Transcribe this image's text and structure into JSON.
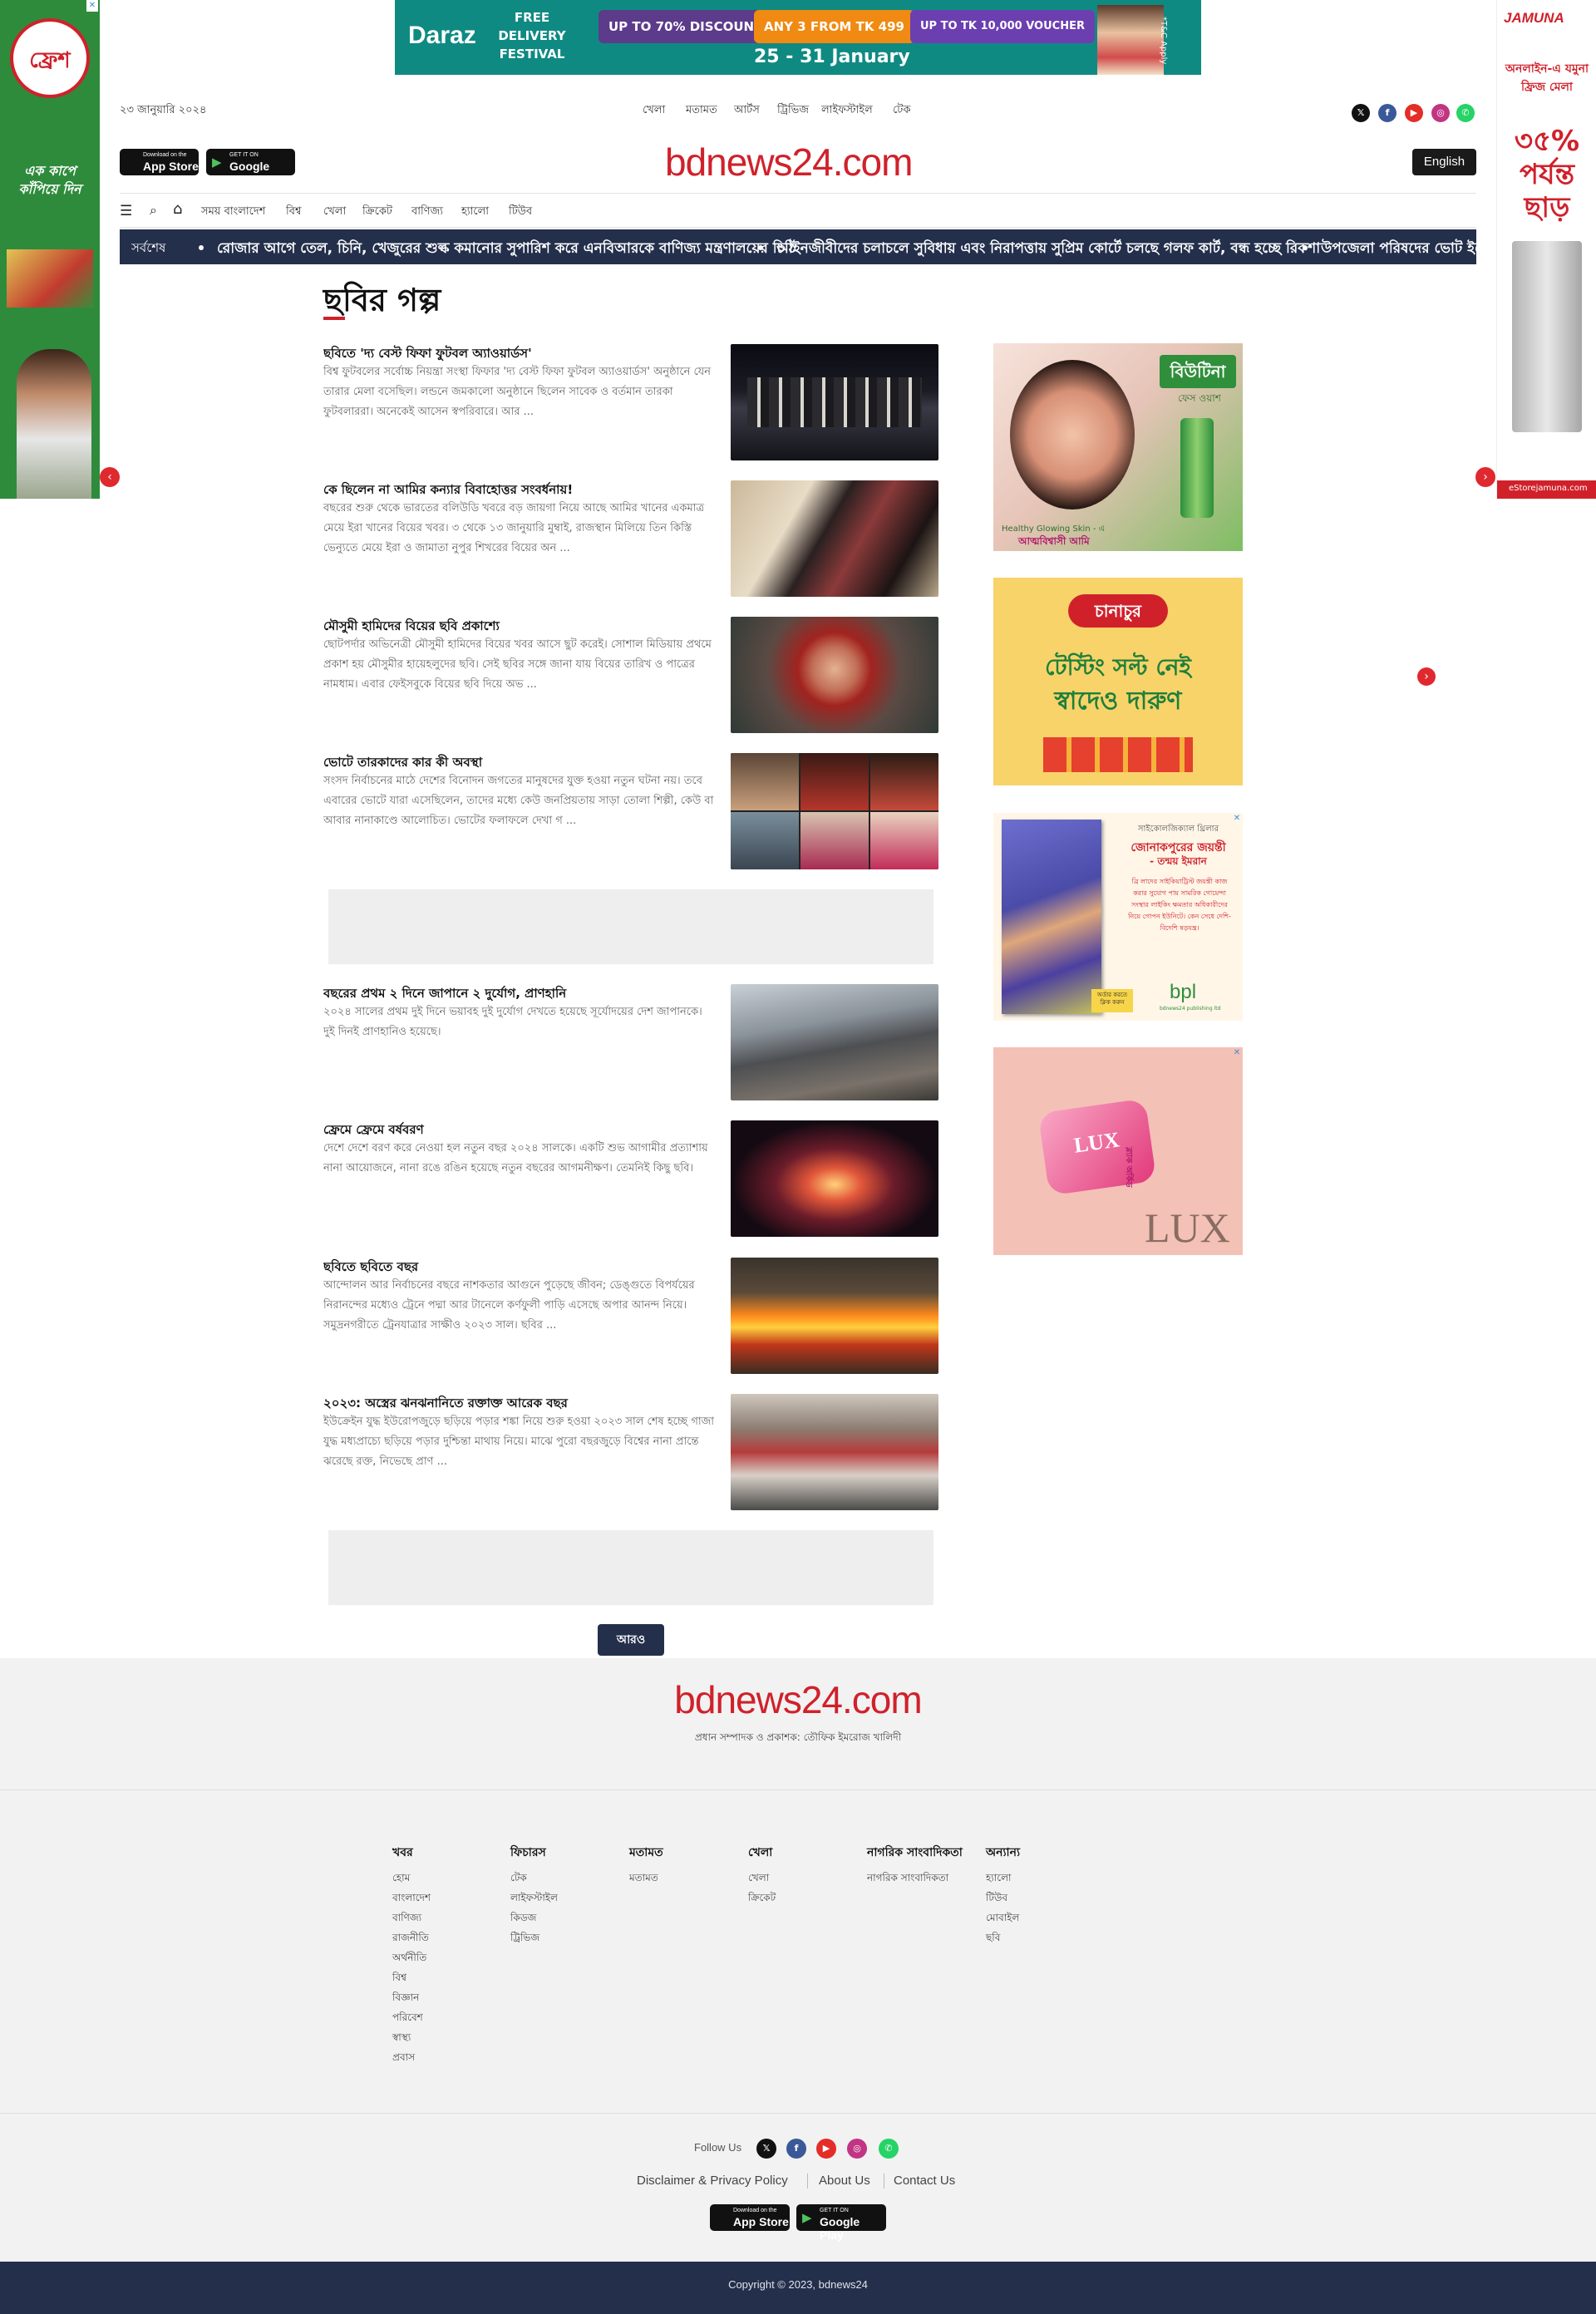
{
  "top_banner": {
    "brand": "Daraz",
    "headline": "FREE DELIVERY FESTIVAL",
    "offers": [
      "UP TO 70% DISCOUNT",
      "ANY 3 FROM TK 499",
      "UP TO TK 10,000 VOUCHER"
    ],
    "dates": "25 - 31 January",
    "note": "*T&C Apply"
  },
  "left_ad": {
    "brand": "ফ্রেশ",
    "slogan": "এক কাপে কাঁপিয়ে দিন"
  },
  "right_ad": {
    "brand": "JAMUNA",
    "tagline": "অনলাইন-এ যমুনা ফ্রিজ মেলা",
    "offer": "৩৫% পর্যন্ত ছাড়",
    "url": "eStorejamuna.com"
  },
  "header": {
    "date": "২৩ জানুয়ারি ২০২৪",
    "top_links": [
      "খেলা",
      "মতামত",
      "আর্টস",
      "ট্রিভিজ",
      "লাইফস্টাইল",
      "টেক"
    ],
    "social": [
      "x-icon",
      "facebook-icon",
      "youtube-icon",
      "instagram-icon",
      "whatsapp-icon"
    ],
    "app_store": {
      "small": "Download on the",
      "big": "App Store"
    },
    "google_play": {
      "small": "GET IT ON",
      "big": "Google Play"
    },
    "logo": "bdnews24.com",
    "english_button": "English"
  },
  "menu": {
    "items": [
      "সময় বাংলাদেশ",
      "বিশ্ব",
      "খেলা",
      "ক্রিকেট",
      "বাণিজ্য",
      "হ্যালো",
      "টিউব"
    ]
  },
  "ticker": {
    "label": "সর্বশেষ",
    "items": [
      "রোজার আগে তেল, চিনি, খেজুরের শুল্ক কমানোর সুপারিশ করে এনবিআরকে বাণিজ্য মন্ত্রণালয়ের চিঠি",
      "আইনজীবীদের চলাচলে সুবিধায় এবং নিরাপত্তায় সুপ্রিম কোর্টে চলছে গলফ কার্ট, বন্ধ হচ্ছে রিকশা",
      "উপজেলা পরিষদের ভোট ইভে"
    ]
  },
  "section": {
    "title": "ছবির গল্প"
  },
  "stories": [
    {
      "title": "ছবিতে 'দ্য বেস্ট ফিফা ফুটবল অ্যাওয়ার্ডস'",
      "body": "বিশ্ব ফুটবলের সর্বোচ্চ নিয়ন্ত্রা সংস্থা ফিফার 'দ্য বেস্ট ফিফা ফুটবল অ্যাওয়ার্ডস' অনুষ্ঠানে যেন তারার মেলা বসেছিল। লন্ডনে জমকালো অনুষ্ঠানে ছিলেন সাবেক ও বর্তমান তারকা ফুটবলাররা। অনেকেই আসেন স্বপরিবারে। আর ..."
    },
    {
      "title": "কে ছিলেন না আমির কন্যার বিবাহোত্তর সংবর্ধনায়!",
      "body": "বছরের শুরু থেকে ভারতের বলিউডি খবরে বড় জায়গা নিয়ে আছে আমির খানের একমাত্র মেয়ে ইরা খানের বিয়ের খবর। ৩ থেকে ১৩ জানুয়ারি মুম্বাই, রাজস্থান মিলিয়ে তিন কিস্তি ভেন্যুতে মেয়ে ইরা ও জামাতা নুপুর শিখরের বিয়ের অন ..."
    },
    {
      "title": "মৌসুমী হামিদের বিয়ের ছবি প্রকাশ্যে",
      "body": "ছোটপর্দার অভিনেত্রী মৌসুমী হামিদের বিয়ের খবর আসে ছুট করেই। সোশাল মিডিয়ায় প্রথমে প্রকাশ হয় মৌসুমীর হায়েহলুদের ছবি। সেই ছবির সঙ্গে জানা যায় বিয়ের তারিখ ও পাত্রের নামধাম। এবার ফেইসবুকে বিয়ের ছবি দিয়ে অভ ..."
    },
    {
      "title": "ভোটে তারকাদের কার কী অবস্থা",
      "body": "সংসদ নির্বাচনের মাঠে দেশের বিনোদন জগতের মানুষদের যুক্ত হওয়া নতুন ঘটনা নয়। তবে এবারের ভোটে যারা এসেছিলেন, তাদের মধ্যে কেউ জনপ্রিয়তায় সাড়া তোলা শিল্পী, কেউ বা আবার নানাকাণ্ডে আলোচিত। ভোটের ফলাফলে দেখা গ ..."
    },
    {
      "title": "বছরের প্রথম ২ দিনে জাপানে ২ দুর্যোগ, প্রাণহানি",
      "body": "২০২৪ সালের প্রথম দুই দিনে ভয়াবহ দুই দুর্যোগ দেখতে হয়েছে সূর্যোদয়ের দেশ জাপানকে। দুই দিনই প্রাণহানিও হয়েছে।"
    },
    {
      "title": "ফ্রেমে ফ্রেমে বর্ষবরণ",
      "body": "দেশে দেশে বরণ করে নেওয়া হল নতুন বছর ২০২৪ সালকে। একটি শুভ আগামীর প্রত্যাশায় নানা আয়োজনে, নানা রঙে রঙিন হয়েছে নতুন বছরের আগমনীক্ষণ। তেমনিই কিছু ছবি।"
    },
    {
      "title": "ছবিতে ছবিতে বছর",
      "body": "আন্দোলন আর নির্বাচনের বছরে নাশকতার আগুনে পুড়েছে জীবন; ডেঙ্গুতে বিপর্যয়ের নিরানন্দের মধ্যেও ট্রেনে পদ্মা আর টানেলে কর্ণফুলী পাড়ি এসেছে অপার আনন্দ নিয়ে। সমুদ্রনগরীতে ট্রেনযাত্রার সাক্ষীও ২০২৩ সাল। ছবির ..."
    },
    {
      "title": "২০২৩: অস্ত্রের ঝনঝনানিতে রক্তাক্ত আরেক বছর",
      "body": "ইউক্রেইন যুদ্ধ ইউরোপজুড়ে ছড়িয়ে পড়ার শঙ্কা নিয়ে শুরু হওয়া ২০২৩ সাল শেষ হচ্ছে গাজা যুদ্ধ মধ্যপ্রাচ্যে ছড়িয়ে পড়ার দুশ্চিন্তা মাথায় নিয়ে। মাঝে পুরো বছরজুড়ে বিশ্বের নানা প্রান্তে ঝরেছে রক্ত, নিভেছে প্রাণ ..."
    }
  ],
  "more_button": "আরও",
  "right_ads": [
    {
      "brand": "বিউটিনা",
      "sub": "ফেস ওয়াশ",
      "caption": "Healthy Glowing Skin - এ",
      "caption2": "আত্মবিশ্বাসী আমি"
    },
    {
      "brand": "চানাচুর",
      "line1": "টেস্টিং সল্ট নেই",
      "line2": "স্বাদেও দারুণ"
    },
    {
      "heading": "সাইকোলজিক্যাল থ্রিলার",
      "title": "জোনাকপুরের জয়ন্তী",
      "author": "- তন্ময় ইমরান",
      "blurb": "ব্রি লাদের সাইকিয়াট্রিস্ট জয়ন্তী কাজ করার সুযোগ পায় সামরিক গোয়েন্দা সংস্থার লাইকিং ক্ষমতার অধিকারীদের নিয়ে গোপন ইউনিটে। কেন সেধে দেশি-বিদেশি ষড়যন্ত্র।",
      "cta": "অর্ডার করতে ক্লিক করুন",
      "publisher": "bpl",
      "pub_sub": "bdnews24 publishing ltd"
    },
    {
      "brand": "LUX",
      "sub": "ব্ল্যাক অর্কিড"
    }
  ],
  "footer": {
    "logo": "bdnews24.com",
    "editor": "প্রধান সম্পাদক ও প্রকাশক: তৌফিক ইমরোজ খালিদী",
    "columns": [
      {
        "heading": "খবর",
        "items": [
          "হোম",
          "বাংলাদেশ",
          "বাণিজ্য",
          "রাজনীতি",
          "অর্থনীতি",
          "বিশ্ব",
          "বিজ্ঞান",
          "পরিবেশ",
          "স্বাস্থ্য",
          "প্রবাস"
        ]
      },
      {
        "heading": "ফিচারস",
        "items": [
          "টেক",
          "লাইফস্টাইল",
          "কিডজ",
          "ট্রিভিজ"
        ]
      },
      {
        "heading": "মতামত",
        "items": [
          "মতামত"
        ]
      },
      {
        "heading": "খেলা",
        "items": [
          "খেলা",
          "ক্রিকেট"
        ]
      },
      {
        "heading": "নাগরিক সাংবাদিকতা",
        "items": [
          "নাগরিক সাংবাদিকতা"
        ]
      },
      {
        "heading": "অন্যান্য",
        "items": [
          "হ্যালো",
          "টিউব",
          "মোবাইল",
          "ছবি"
        ]
      }
    ],
    "follow_us": "Follow Us",
    "links": [
      "Disclaimer & Privacy Policy",
      "About Us",
      "Contact Us"
    ],
    "copyright": "Copyright © 2023, bdnews24"
  },
  "colors": {
    "brand_red": "#d0212b",
    "navy": "#232f4b",
    "footer_bg": "#f2f2f2"
  }
}
